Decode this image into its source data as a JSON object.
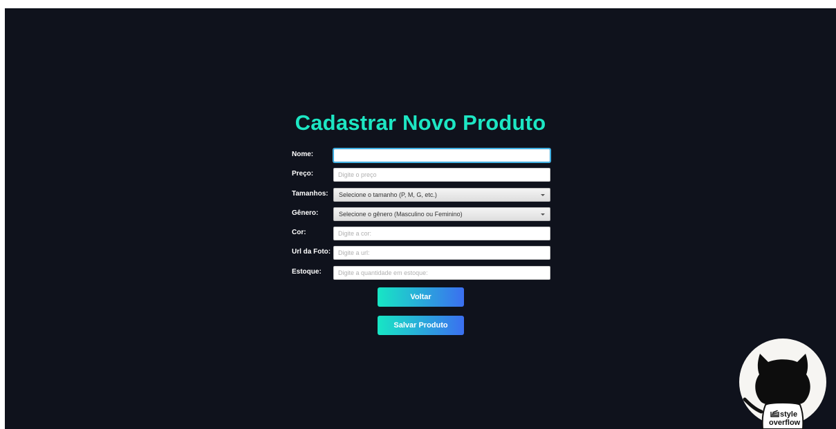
{
  "form": {
    "title": "Cadastrar Novo Produto",
    "fields": [
      {
        "label": "Nome:",
        "value": "",
        "placeholder": ""
      },
      {
        "label": "Preço:",
        "value": "",
        "placeholder": "Digite o preço"
      },
      {
        "label": "Tamanhos:",
        "selected": "Selecione o tamanho (P, M, G, etc.)"
      },
      {
        "label": "Gênero:",
        "selected": "Selecione o gênero (Masculino ou Feminino)"
      },
      {
        "label": "Cor:",
        "value": "",
        "placeholder": "Digite a cor:"
      },
      {
        "label": "Url da Foto:",
        "value": "",
        "placeholder": "Digite a url:"
      },
      {
        "label": "Estoque:",
        "value": "",
        "placeholder": "Digite a quantidade em estoque:"
      }
    ],
    "back_label": "Voltar",
    "save_label": "Salvar Produto"
  },
  "badge": {
    "line1": "style",
    "line2": "overflow",
    "icon": "github-octocat-icon"
  },
  "colors": {
    "background": "#0f121c",
    "title": "#1de6c3",
    "button_gradient_start": "#17e6c4",
    "button_gradient_end": "#3b6ff0"
  }
}
